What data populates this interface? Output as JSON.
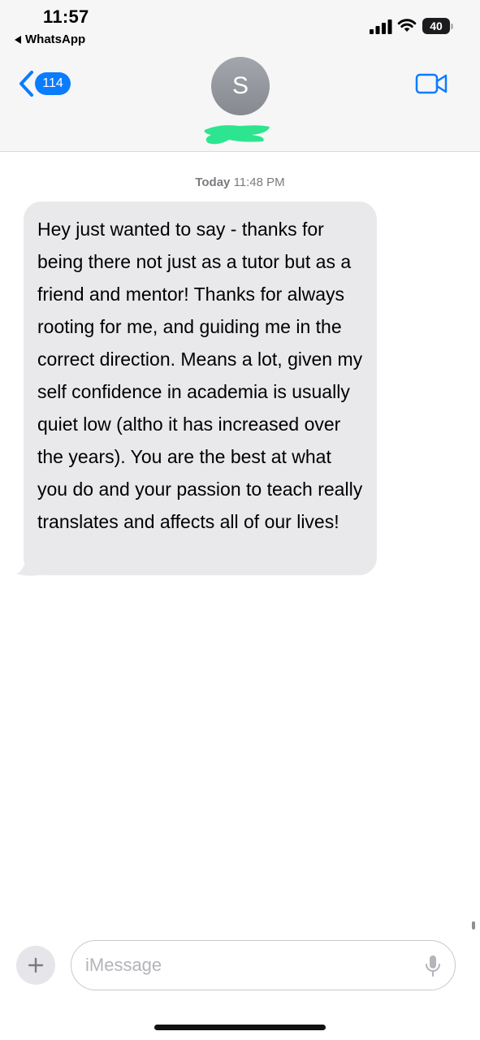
{
  "status_bar": {
    "time": "11:57",
    "back_app": "WhatsApp",
    "battery": "40"
  },
  "nav": {
    "unread_count": "114",
    "contact_initial": "S"
  },
  "conversation": {
    "date_label": "Today",
    "time_label": "11:48 PM",
    "messages": [
      {
        "text": "Hey just wanted to say - thanks for being there not just as a tutor but as a friend and mentor! Thanks for always rooting for me, and guiding me in the correct direction. Means a lot, given my self confidence in academia is usually quiet low (altho it has increased over the years). You are the best at what you do and your passion to teach really translates and affects all of our lives!"
      }
    ]
  },
  "composer": {
    "placeholder": "iMessage"
  },
  "colors": {
    "accent": "#0a7cff",
    "bubble_received": "#e9e9eb",
    "redaction": "#2ee58f"
  },
  "icons": {
    "back": "chevron-left-icon",
    "video": "video-camera-icon",
    "add": "plus-icon",
    "dictation": "microphone-icon",
    "signal": "cellular-signal-icon",
    "wifi": "wifi-icon",
    "battery": "battery-icon"
  }
}
